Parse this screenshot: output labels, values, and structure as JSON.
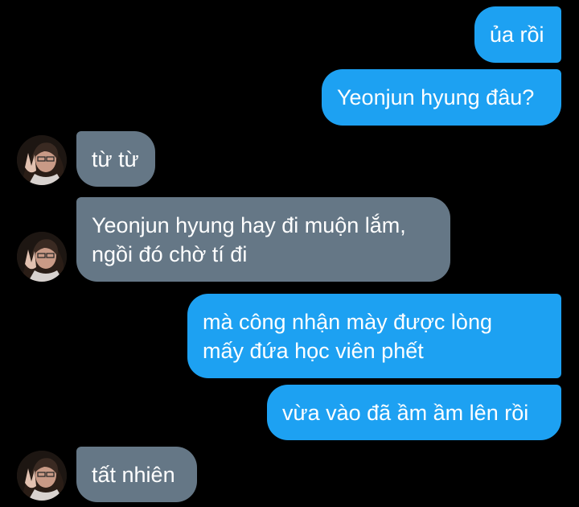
{
  "conversation": {
    "messages": [
      {
        "from": "me",
        "lines": [
          "ủa rồi"
        ]
      },
      {
        "from": "me",
        "lines": [
          "Yeonjun hyung đâu?"
        ]
      },
      {
        "from": "other",
        "lines": [
          "từ từ"
        ]
      },
      {
        "from": "other",
        "lines": [
          "Yeonjun hyung hay đi muộn lắm,",
          "ngồi đó chờ tí đi"
        ]
      },
      {
        "from": "me",
        "lines": [
          "mà công nhận mày được lòng",
          "mấy đứa học viên phết"
        ]
      },
      {
        "from": "me",
        "lines": [
          "vừa vào đã ầm ầm lên rồi"
        ]
      },
      {
        "from": "other",
        "lines": [
          "tất nhiên"
        ]
      }
    ],
    "avatar_icon": "avatar-peace-sign-photo",
    "colors": {
      "background": "#000000",
      "sent_bubble": "#1da1f2",
      "received_bubble": "#657786",
      "text": "#ffffff"
    }
  }
}
